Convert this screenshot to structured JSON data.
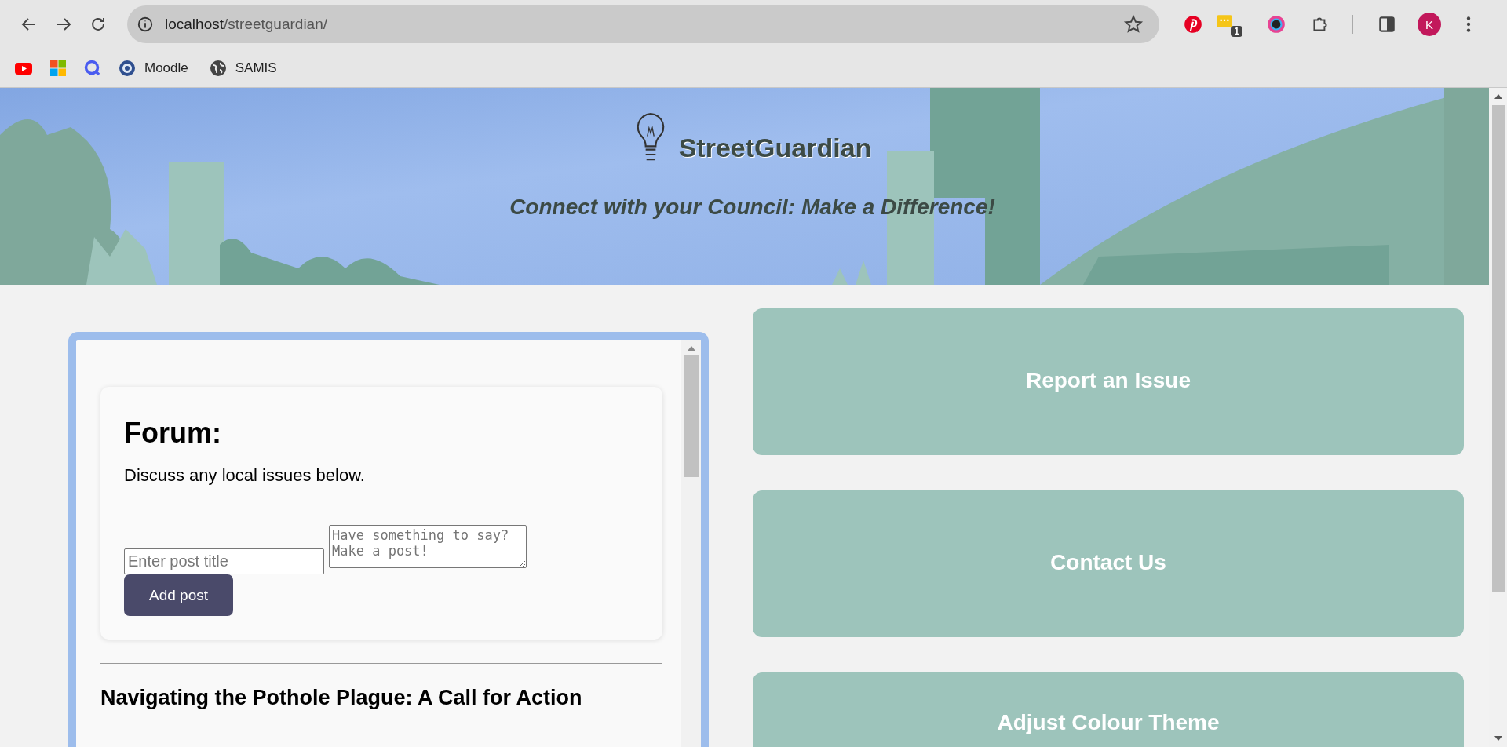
{
  "browser": {
    "url_host": "localhost",
    "url_path": "/streetguardian/",
    "bookmarks": [
      {
        "label": "Moodle"
      },
      {
        "label": "SAMIS"
      }
    ],
    "extension_badge": "1",
    "profile_initial": "K"
  },
  "header": {
    "title": "StreetGuardian",
    "tagline": "Connect with your Council: Make a Difference!"
  },
  "forum": {
    "heading": "Forum:",
    "description": "Discuss any local issues below.",
    "title_placeholder": "Enter post title",
    "body_placeholder": "Have something to say? Make a post!",
    "add_button": "Add post",
    "posts": [
      {
        "title": "Navigating the Pothole Plague: A Call for Action"
      }
    ]
  },
  "actions": [
    {
      "label": "Report an Issue"
    },
    {
      "label": "Contact Us"
    },
    {
      "label": "Adjust Colour Theme"
    }
  ]
}
